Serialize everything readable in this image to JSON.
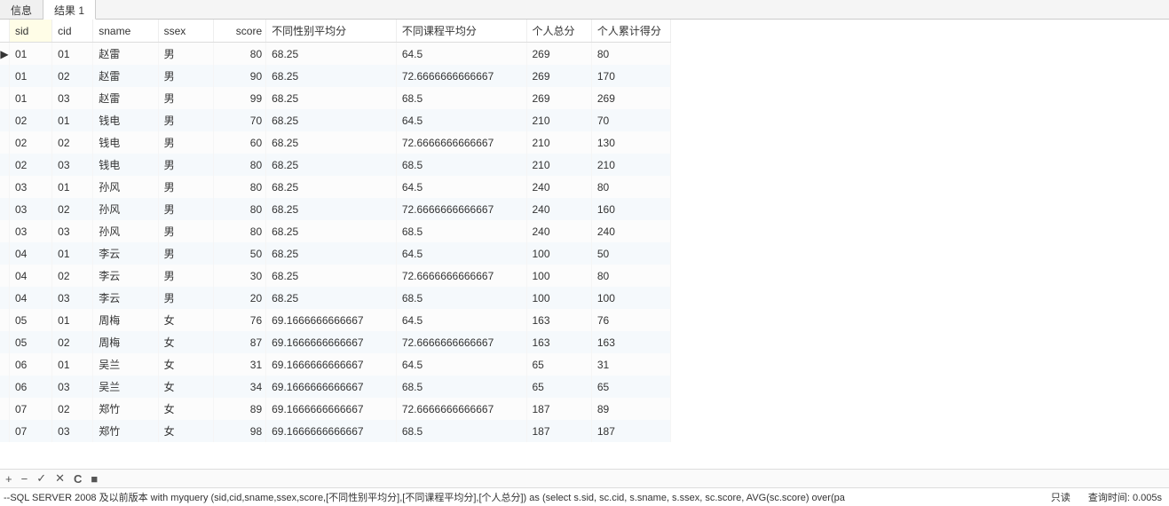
{
  "tabs": {
    "info": "信息",
    "result": "结果 1"
  },
  "columns": {
    "sid": "sid",
    "cid": "cid",
    "sname": "sname",
    "ssex": "ssex",
    "score": "score",
    "avg_sex": "不同性别平均分",
    "avg_course": "不同课程平均分",
    "sum_p": "个人总分",
    "cum_p": "个人累计得分"
  },
  "rows": [
    {
      "sid": "01",
      "cid": "01",
      "sname": "赵雷",
      "ssex": "男",
      "score": "80",
      "avg_sex": "68.25",
      "avg_course": "64.5",
      "sum_p": "269",
      "cum_p": "80"
    },
    {
      "sid": "01",
      "cid": "02",
      "sname": "赵雷",
      "ssex": "男",
      "score": "90",
      "avg_sex": "68.25",
      "avg_course": "72.6666666666667",
      "sum_p": "269",
      "cum_p": "170"
    },
    {
      "sid": "01",
      "cid": "03",
      "sname": "赵雷",
      "ssex": "男",
      "score": "99",
      "avg_sex": "68.25",
      "avg_course": "68.5",
      "sum_p": "269",
      "cum_p": "269"
    },
    {
      "sid": "02",
      "cid": "01",
      "sname": "钱电",
      "ssex": "男",
      "score": "70",
      "avg_sex": "68.25",
      "avg_course": "64.5",
      "sum_p": "210",
      "cum_p": "70"
    },
    {
      "sid": "02",
      "cid": "02",
      "sname": "钱电",
      "ssex": "男",
      "score": "60",
      "avg_sex": "68.25",
      "avg_course": "72.6666666666667",
      "sum_p": "210",
      "cum_p": "130"
    },
    {
      "sid": "02",
      "cid": "03",
      "sname": "钱电",
      "ssex": "男",
      "score": "80",
      "avg_sex": "68.25",
      "avg_course": "68.5",
      "sum_p": "210",
      "cum_p": "210"
    },
    {
      "sid": "03",
      "cid": "01",
      "sname": "孙风",
      "ssex": "男",
      "score": "80",
      "avg_sex": "68.25",
      "avg_course": "64.5",
      "sum_p": "240",
      "cum_p": "80"
    },
    {
      "sid": "03",
      "cid": "02",
      "sname": "孙风",
      "ssex": "男",
      "score": "80",
      "avg_sex": "68.25",
      "avg_course": "72.6666666666667",
      "sum_p": "240",
      "cum_p": "160"
    },
    {
      "sid": "03",
      "cid": "03",
      "sname": "孙风",
      "ssex": "男",
      "score": "80",
      "avg_sex": "68.25",
      "avg_course": "68.5",
      "sum_p": "240",
      "cum_p": "240"
    },
    {
      "sid": "04",
      "cid": "01",
      "sname": "李云",
      "ssex": "男",
      "score": "50",
      "avg_sex": "68.25",
      "avg_course": "64.5",
      "sum_p": "100",
      "cum_p": "50"
    },
    {
      "sid": "04",
      "cid": "02",
      "sname": "李云",
      "ssex": "男",
      "score": "30",
      "avg_sex": "68.25",
      "avg_course": "72.6666666666667",
      "sum_p": "100",
      "cum_p": "80"
    },
    {
      "sid": "04",
      "cid": "03",
      "sname": "李云",
      "ssex": "男",
      "score": "20",
      "avg_sex": "68.25",
      "avg_course": "68.5",
      "sum_p": "100",
      "cum_p": "100"
    },
    {
      "sid": "05",
      "cid": "01",
      "sname": "周梅",
      "ssex": "女",
      "score": "76",
      "avg_sex": "69.1666666666667",
      "avg_course": "64.5",
      "sum_p": "163",
      "cum_p": "76"
    },
    {
      "sid": "05",
      "cid": "02",
      "sname": "周梅",
      "ssex": "女",
      "score": "87",
      "avg_sex": "69.1666666666667",
      "avg_course": "72.6666666666667",
      "sum_p": "163",
      "cum_p": "163"
    },
    {
      "sid": "06",
      "cid": "01",
      "sname": "吴兰",
      "ssex": "女",
      "score": "31",
      "avg_sex": "69.1666666666667",
      "avg_course": "64.5",
      "sum_p": "65",
      "cum_p": "31"
    },
    {
      "sid": "06",
      "cid": "03",
      "sname": "吴兰",
      "ssex": "女",
      "score": "34",
      "avg_sex": "69.1666666666667",
      "avg_course": "68.5",
      "sum_p": "65",
      "cum_p": "65"
    },
    {
      "sid": "07",
      "cid": "02",
      "sname": "郑竹",
      "ssex": "女",
      "score": "89",
      "avg_sex": "69.1666666666667",
      "avg_course": "72.6666666666667",
      "sum_p": "187",
      "cum_p": "89"
    },
    {
      "sid": "07",
      "cid": "03",
      "sname": "郑竹",
      "ssex": "女",
      "score": "98",
      "avg_sex": "69.1666666666667",
      "avg_course": "68.5",
      "sum_p": "187",
      "cum_p": "187"
    }
  ],
  "toolbar": {
    "plus": "+",
    "minus": "−",
    "check": "✓",
    "cross": "✕",
    "refresh": "C",
    "stop": "■"
  },
  "status": {
    "sql": "--SQL SERVER 2008 及以前版本 with myquery (sid,cid,sname,ssex,score,[不同性别平均分],[不同课程平均分],[个人总分]) as  (select   s.sid,   sc.cid,   s.sname,   s.ssex,   sc.score,   AVG(sc.score) over(pa",
    "readonly": "只读",
    "time_label": "查询时间: 0.005s"
  }
}
